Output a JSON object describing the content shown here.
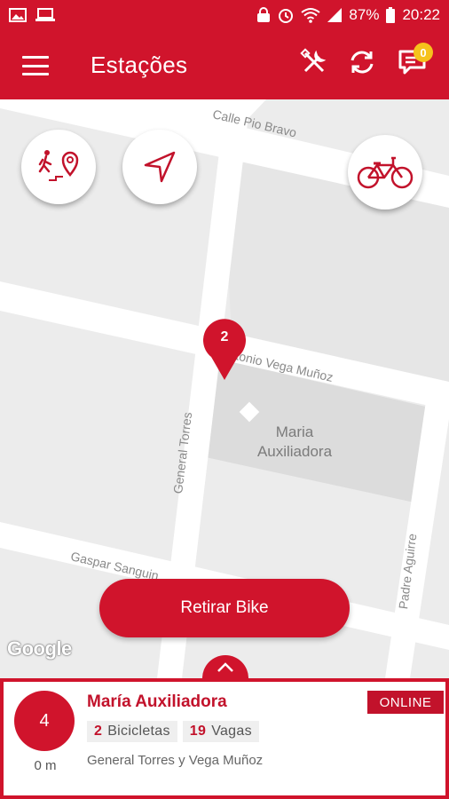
{
  "statusbar": {
    "battery": "87%",
    "time": "20:22"
  },
  "appbar": {
    "title": "Estações",
    "notification_count": "0"
  },
  "map": {
    "streets": {
      "pio_bravo": "Calle Pio Bravo",
      "vega_munoz": "tonio Vega Muñoz",
      "general_torres": "General Torres",
      "gaspar": "Gaspar Sanguin",
      "padre_aguirre": "Padre Aguirre"
    },
    "poi": "Maria\nAuxiliadora",
    "marker_count": "2",
    "google_logo": "Google"
  },
  "actions": {
    "retirar": "Retirar Bike"
  },
  "station": {
    "bikes_circle": "4",
    "distance": "0 m",
    "name": "María Auxiliadora",
    "status": "ONLINE",
    "bikes_count": "2",
    "bikes_label": "Bicicletas",
    "slots_count": "19",
    "slots_label": "Vagas",
    "address": "General Torres y Vega Muñoz"
  },
  "colors": {
    "primary": "#d0142c",
    "accent_badge": "#f6c21c"
  }
}
